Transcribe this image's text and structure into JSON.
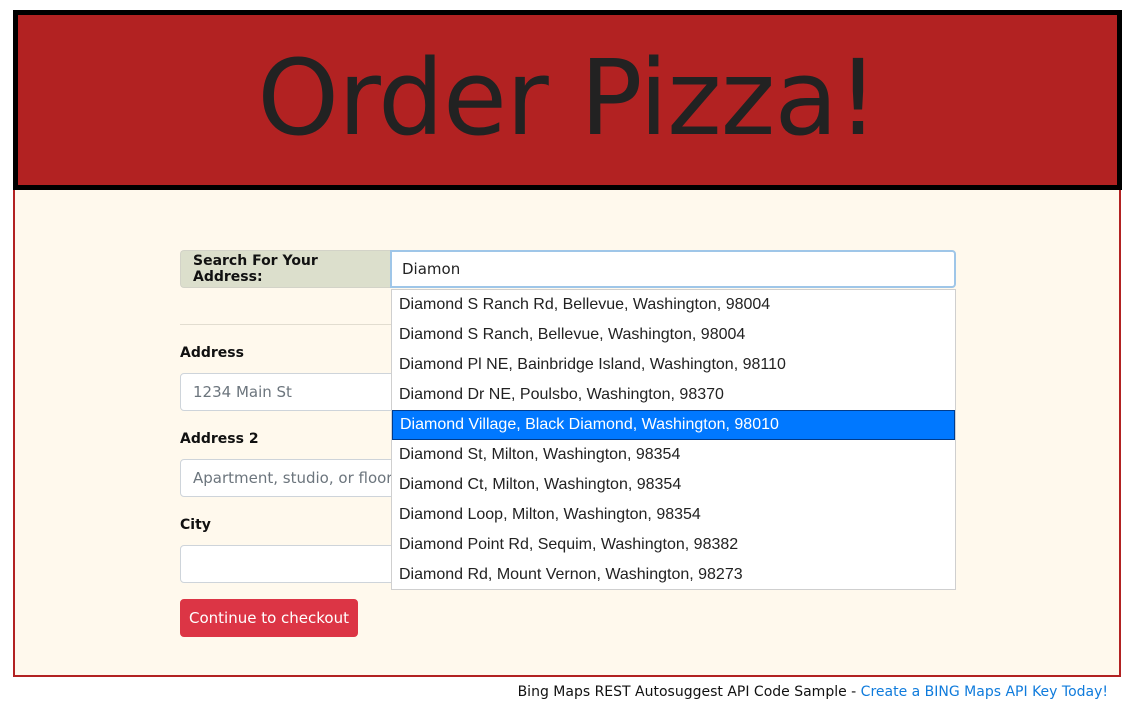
{
  "header": {
    "title": "Order Pizza!"
  },
  "search": {
    "label": "Search For Your Address:",
    "value": "Diamon",
    "suggestions": [
      "Diamond S Ranch Rd, Bellevue, Washington, 98004",
      "Diamond S Ranch, Bellevue, Washington, 98004",
      "Diamond Pl NE, Bainbridge Island, Washington, 98110",
      "Diamond Dr NE, Poulsbo, Washington, 98370",
      "Diamond Village, Black Diamond, Washington, 98010",
      "Diamond St, Milton, Washington, 98354",
      "Diamond Ct, Milton, Washington, 98354",
      "Diamond Loop, Milton, Washington, 98354",
      "Diamond Point Rd, Sequim, Washington, 98382",
      "Diamond Rd, Mount Vernon, Washington, 98273"
    ],
    "selected_index": 4
  },
  "form": {
    "address": {
      "label": "Address",
      "value": "",
      "placeholder": "1234 Main St"
    },
    "address2": {
      "label": "Address 2",
      "value": "",
      "placeholder": "Apartment, studio, or floor"
    },
    "city": {
      "label": "City",
      "value": "",
      "placeholder": ""
    },
    "checkout_label": "Continue to checkout"
  },
  "footer": {
    "text": "Bing Maps REST Autosuggest API Code Sample - ",
    "link_text": "Create a BING Maps API Key Today!"
  },
  "colors": {
    "banner": "#b22222",
    "page_background": "#fff9ed",
    "button": "#dc3545",
    "highlight": "#0078ff",
    "link": "#0f7bdc"
  }
}
